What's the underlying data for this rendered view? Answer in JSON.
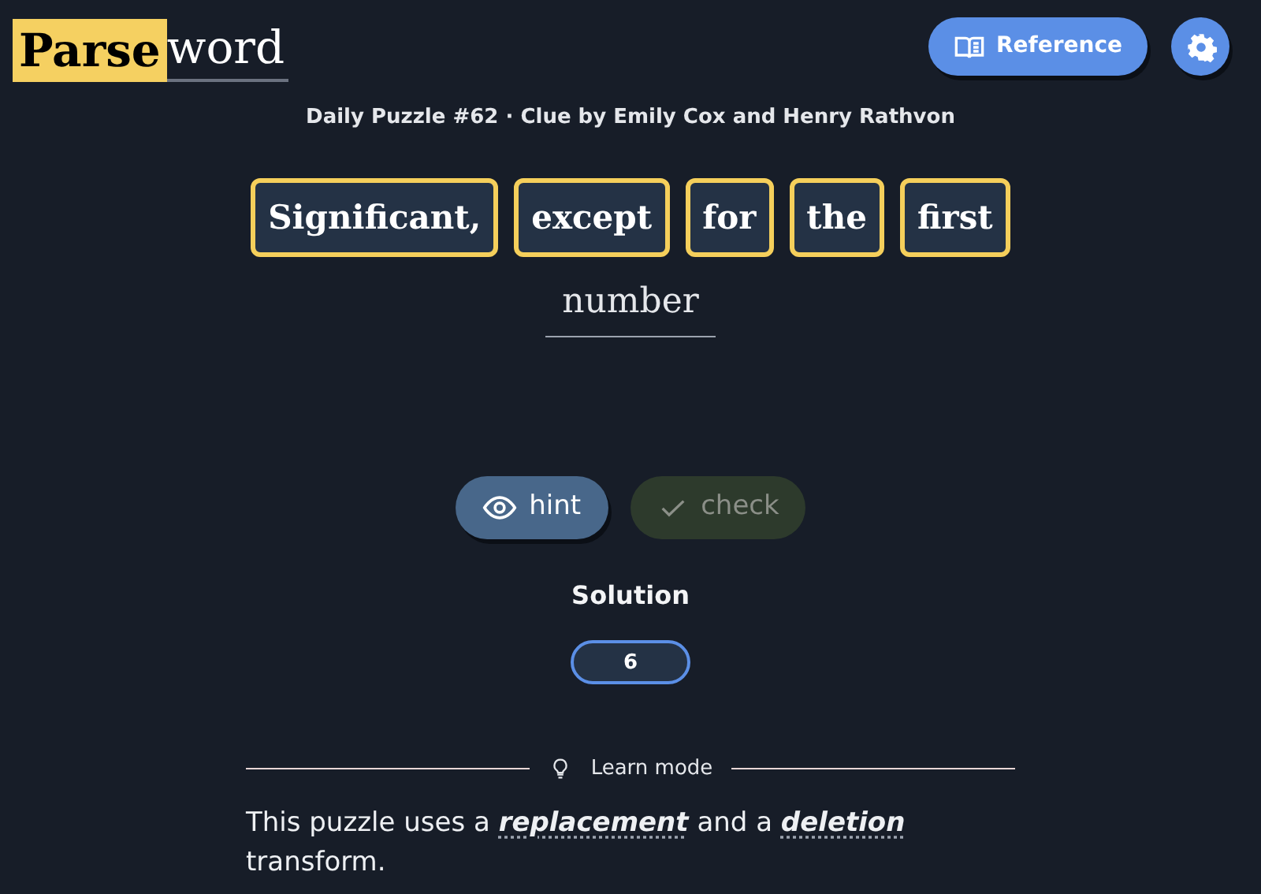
{
  "logo": {
    "highlight": "Parse",
    "rest": "word"
  },
  "header_buttons": [
    {
      "kind": "reference",
      "label": "Reference"
    },
    {
      "kind": "settings"
    }
  ],
  "subtitle": "Daily Puzzle #62 · Clue by Emily Cox and Henry Rathvon",
  "clue_words": [
    {
      "text": "Significant,",
      "kind": "indicator"
    },
    {
      "text": "except",
      "kind": "indicator"
    },
    {
      "text": "for",
      "kind": "indicator"
    },
    {
      "text": "the",
      "kind": "indicator"
    },
    {
      "text": "first",
      "kind": "indicator"
    },
    {
      "text": "number",
      "kind": "definition"
    }
  ],
  "actions": [
    {
      "kind": "hint",
      "label": "hint",
      "disabled": false
    },
    {
      "kind": "check",
      "label": "check",
      "disabled": true
    }
  ],
  "solution": {
    "label": "Solution",
    "value": "6"
  },
  "learn_mode": {
    "label": "Learn mode",
    "sentence": [
      {
        "kind": "text",
        "text": "This puzzle uses a"
      },
      {
        "kind": "link",
        "text": "replacement"
      },
      {
        "kind": "text",
        "text": "and a"
      },
      {
        "kind": "link",
        "text": "deletion"
      },
      {
        "kind": "text",
        "text": "transform."
      }
    ]
  }
}
